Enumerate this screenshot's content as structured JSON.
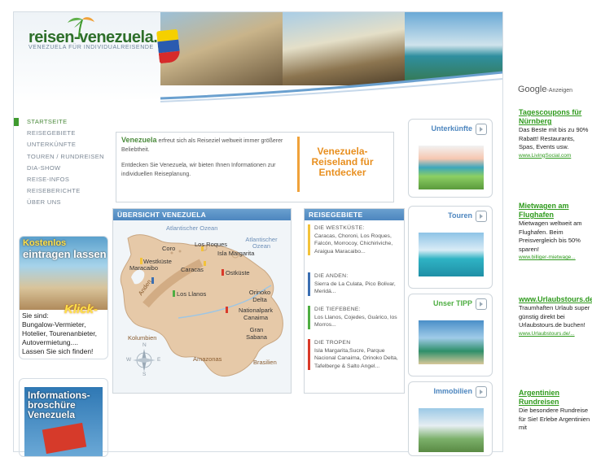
{
  "header": {
    "logo": "reisen-venezuela.de",
    "tagline": "VENEZUELA FÜR INDIVIDUALREISENDE"
  },
  "nav": {
    "items": [
      {
        "label": "STARTSEITE",
        "active": true
      },
      {
        "label": "REISEGEBIETE"
      },
      {
        "label": "UNTERKÜNFTE"
      },
      {
        "label": "TOUREN / RUNDREISEN"
      },
      {
        "label": "DIA-SHOW"
      },
      {
        "label": "REISE-INFOS"
      },
      {
        "label": "REISEBERICHTE"
      },
      {
        "label": "ÜBER UNS"
      }
    ]
  },
  "promo": {
    "headline1": "Kostenlos",
    "headline2": "eintragen lassen",
    "klick": "Klick-",
    "lines": [
      "Sie sind:",
      "Bungalow-Vermieter,",
      "Hotelier, Tourenanbieter,",
      "Autovermietung....",
      "Lassen Sie sich finden!"
    ]
  },
  "promo2": {
    "title_lines": [
      "Informations-",
      "broschüre",
      "Venezuela"
    ]
  },
  "intro": {
    "brand": "Venezuela",
    "text1": " erfreut sich als Reiseziel weltweit immer größerer Beliebtheit.",
    "text2": "Entdecken Sie Venezuela, wir bieten Ihnen Informationen zur individuellen Reiseplanung.",
    "slogan": [
      "Venezuela-",
      "Reiseland für",
      "Entdecker"
    ]
  },
  "overview": {
    "title": "ÜBERSICHT VENEZUELA",
    "labels": {
      "atl1": "Atlantischer Ozean",
      "atl2": "Atlantischer Ozean",
      "coro": "Coro",
      "losroques": "Los Roques",
      "westkueste": "Westküste",
      "isla": "Isla Margarita",
      "maracaibo": "Maracaibo",
      "caracas": "Caracas",
      "ostkueste": "Ostküste",
      "anden": "Anden",
      "losllanos": "Los Llanos",
      "orinoko": "Orinoko Delta",
      "nationalpark": "Nationalpark Canaima",
      "gransabana": "Gran Sabana",
      "kolumbien": "Kolumbien",
      "amazonas": "Amazonas",
      "brasilien": "Brasilien",
      "compass_n": "N",
      "compass_s": "S",
      "compass_w": "W",
      "compass_e": "E"
    }
  },
  "regions": {
    "title": "REISEGEBIETE",
    "items": [
      {
        "title": "DIE WESTKÜSTE:",
        "body": "Caracas, Choroni, Los Roques, Falcón, Morrocoy, Chichiriviche, Araigua Maracaibo...",
        "color": "#f2c23a"
      },
      {
        "title": "DIE ANDEN:",
        "body": "Sierra de La Culata, Pico Bolivar, Meridá...",
        "color": "#3b6fb2"
      },
      {
        "title": "DIE TIEFEBENE:",
        "body": "Los Llanos, Cojedes, Guárico, los Morros...",
        "color": "#4fae43"
      },
      {
        "title": "DIE TROPEN",
        "body": "Isla Margarita,Sucre, Parque Nacional Canaima, Orinoko Delta, Tafelberge & Salto Angel...",
        "color": "#d93a2a"
      }
    ]
  },
  "sidebar_boxes": [
    {
      "label": "Unterkünfte"
    },
    {
      "label": "Touren"
    },
    {
      "label": "Unser TIPP"
    },
    {
      "label": "Immobilien"
    }
  ],
  "ads": {
    "google": "Google",
    "anzeigen": "-Anzeigen",
    "items": [
      {
        "title": "Tagescoupons für Nürnberg",
        "text": "Das Beste mit bis zu 90% Rabatt! Restaurants, Spas, Events usw.",
        "url": "www.LivingSocial.com"
      },
      {
        "title": "Mietwagen am Flughafen",
        "text": "Mietwagen weltweit am Flughafen. Beim Preisvergleich bis 50% sparen!",
        "url": "www.billiger-mietwage..."
      },
      {
        "title": "www.Urlaubstours.de",
        "text": "Traumhaften Urlaub super günstig direkt bei Urlaubstours.de buchen!",
        "url": "www.Urlaubstours.de/..."
      },
      {
        "title": "Argentinien Rundreisen",
        "text": "Die besondere Rundreise für Sie! Erlebe Argentinien mit",
        "url": ""
      }
    ]
  }
}
